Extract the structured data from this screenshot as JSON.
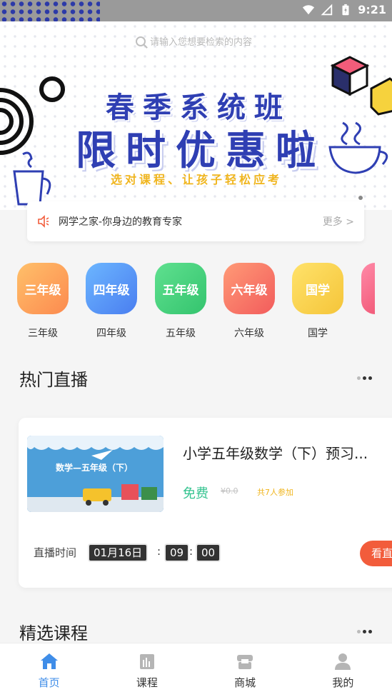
{
  "status_bar": {
    "time": "9:21"
  },
  "banner": {
    "search_placeholder": "请输入您想要检索的内容",
    "title_line1": "春季系统班",
    "title_line2": "限时优惠啦",
    "subtitle": "选对课程、让孩子轻松应考"
  },
  "notice": {
    "text": "网学之家-你身边的教育专家",
    "more": "更多 >"
  },
  "grades": [
    {
      "badge": "三年级",
      "label": "三年级",
      "color": "#fca75c"
    },
    {
      "badge": "四年级",
      "label": "四年级",
      "color": "#5a9ef7"
    },
    {
      "badge": "五年级",
      "label": "五年级",
      "color": "#46d58b"
    },
    {
      "badge": "六年级",
      "label": "六年级",
      "color": "#f7775e"
    },
    {
      "badge": "国学",
      "label": "国学",
      "color": "#f8d04d"
    }
  ],
  "hot_live": {
    "title": "热门直播",
    "course": {
      "thumb_text": "数学—五年级（下）",
      "title": "小学五年级数学（下）预习...",
      "price": "免费",
      "old_price": "¥0.0",
      "enrolled": "共7人参加",
      "time_label": "直播时间",
      "date": "01月16日",
      "hour": "09",
      "minute": "00",
      "button": "看直"
    }
  },
  "featured": {
    "title": "精选课程"
  },
  "tabbar": {
    "items": [
      {
        "label": "首页",
        "icon": "home-icon",
        "active": true
      },
      {
        "label": "课程",
        "icon": "course-icon"
      },
      {
        "label": "商城",
        "icon": "store-icon"
      },
      {
        "label": "我的",
        "icon": "user-icon"
      }
    ]
  },
  "colors": {
    "accent": "#3f8de8",
    "banner_blue": "#2f3fb3",
    "free": "#34c38f",
    "cta": "#f25c3b"
  }
}
